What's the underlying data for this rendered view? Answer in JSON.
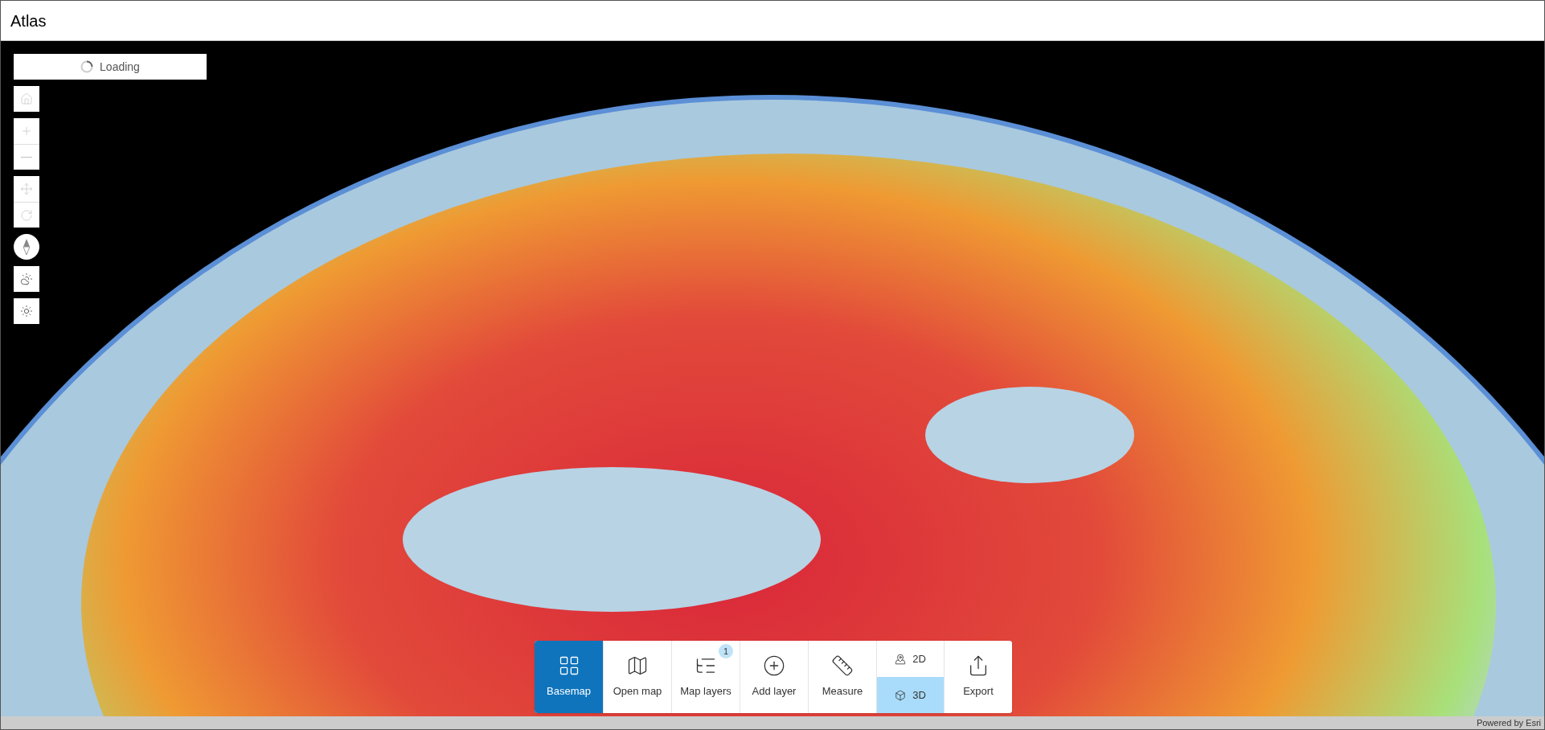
{
  "header": {
    "title": "Atlas"
  },
  "loading": {
    "label": "Loading"
  },
  "map_controls": [
    {
      "kind": "home",
      "disabled": true
    },
    {
      "kind": "zoom-in",
      "disabled": true
    },
    {
      "kind": "zoom-out",
      "disabled": true
    },
    {
      "kind": "pan",
      "disabled": true
    },
    {
      "kind": "rotate",
      "disabled": true
    },
    {
      "kind": "compass",
      "disabled": false
    },
    {
      "kind": "weather",
      "disabled": false
    },
    {
      "kind": "daylight",
      "disabled": false
    }
  ],
  "toolbar": [
    {
      "kind": "basemap",
      "label": "Basemap",
      "selected": true
    },
    {
      "kind": "open-map",
      "label": "Open map",
      "selected": false
    },
    {
      "kind": "layers",
      "label": "Map layers",
      "selected": false,
      "badge": "1"
    },
    {
      "kind": "add-layer",
      "label": "Add layer",
      "selected": false
    },
    {
      "kind": "measure",
      "label": "Measure",
      "selected": false
    },
    {
      "kind": "view-toggle",
      "options": [
        {
          "label": "2D",
          "selected": false
        },
        {
          "label": "3D",
          "selected": true
        }
      ]
    },
    {
      "kind": "export",
      "label": "Export",
      "selected": false
    }
  ],
  "attribution": "Powered by Esri"
}
